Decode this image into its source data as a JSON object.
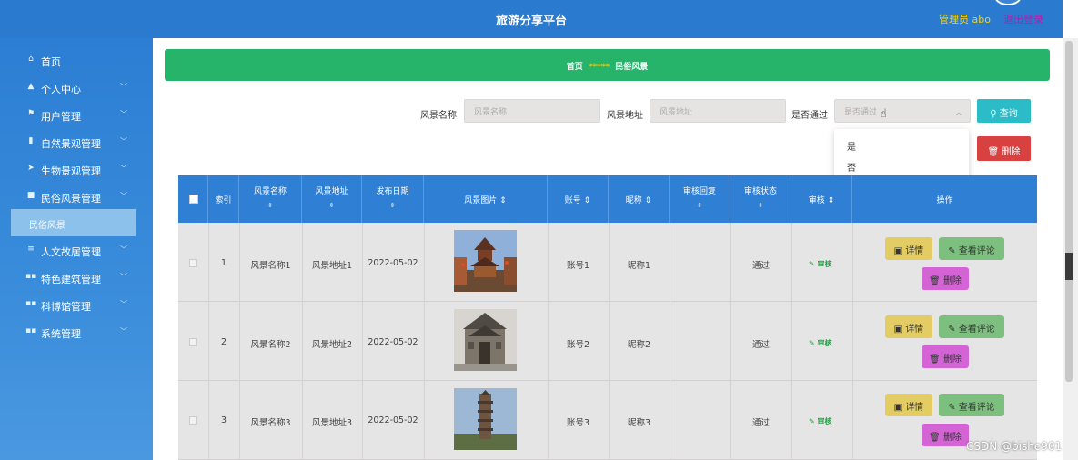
{
  "header": {
    "title": "旅游分享平台",
    "admin": "管理员 abo",
    "logout": "退出登录"
  },
  "sidebar": {
    "items": [
      {
        "label": "首页",
        "icon": "home-icon"
      },
      {
        "label": "个人中心",
        "icon": "user-icon"
      },
      {
        "label": "用户管理",
        "icon": "flag-icon"
      },
      {
        "label": "自然景观管理",
        "icon": "chart-icon"
      },
      {
        "label": "生物景观管理",
        "icon": "send-icon"
      },
      {
        "label": "民俗风景管理",
        "icon": "chat-icon"
      },
      {
        "label": "人文故居管理",
        "icon": "list-icon"
      },
      {
        "label": "特色建筑管理",
        "icon": "grid-icon"
      },
      {
        "label": "科博馆管理",
        "icon": "grid-icon"
      },
      {
        "label": "系统管理",
        "icon": "grid-icon"
      }
    ],
    "active_sub": "民俗风景"
  },
  "breadcrumb": {
    "home": "首页",
    "sep": "*****",
    "current": "民俗风景"
  },
  "search": {
    "name_label": "风景名称",
    "name_placeholder": "风景名称",
    "addr_label": "风景地址",
    "addr_placeholder": "风景地址",
    "pass_label": "是否通过",
    "pass_placeholder": "是否通过",
    "query_btn": "查询",
    "delete_btn": "删除",
    "options": [
      "是",
      "否"
    ]
  },
  "table": {
    "headers": {
      "index": "索引",
      "name": "风景名称",
      "addr": "风景地址",
      "date": "发布日期",
      "image": "风景图片",
      "account": "账号",
      "nick": "昵称",
      "reply": "审核回复",
      "status": "审核状态",
      "audit": "审核",
      "ops": "操作"
    },
    "rows": [
      {
        "index": "1",
        "name": "风景名称1",
        "addr": "风景地址1",
        "date": "2022-05-02",
        "account": "账号1",
        "nick": "昵称1",
        "reply": "",
        "status": "通过",
        "audit": "审核"
      },
      {
        "index": "2",
        "name": "风景名称2",
        "addr": "风景地址2",
        "date": "2022-05-02",
        "account": "账号2",
        "nick": "昵称2",
        "reply": "",
        "status": "通过",
        "audit": "审核"
      },
      {
        "index": "3",
        "name": "风景名称3",
        "addr": "风景地址3",
        "date": "2022-05-02",
        "account": "账号3",
        "nick": "昵称3",
        "reply": "",
        "status": "通过",
        "audit": "审核"
      }
    ],
    "actions": {
      "detail": "详情",
      "comment": "查看评论",
      "delete": "删除"
    }
  },
  "watermark": "CSDN @bishe901",
  "colors": {
    "header_bg": "#2a7ad0",
    "breadcrumb_bg": "#26b36a",
    "table_head_bg": "#2f7fd5",
    "query_btn": "#2bbcc7",
    "delete_btn": "#d94040"
  }
}
